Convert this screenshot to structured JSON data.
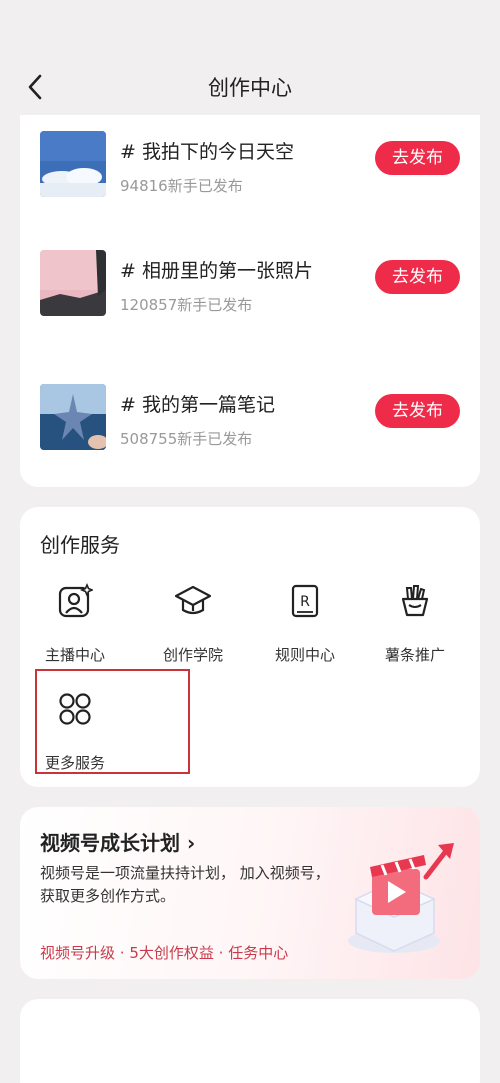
{
  "header": {
    "title": "创作中心"
  },
  "tasks": [
    {
      "title": "# 我拍下的今日天空",
      "sub": "94816新手已发布",
      "button": "去发布"
    },
    {
      "title": "# 相册里的第一张照片",
      "sub": "120857新手已发布",
      "button": "去发布"
    },
    {
      "title": "# 我的第一篇笔记",
      "sub": "508755新手已发布",
      "button": "去发布"
    }
  ],
  "services": {
    "title": "创作服务",
    "items": [
      {
        "label": "主播中心",
        "icon": "anchor-center-icon"
      },
      {
        "label": "创作学院",
        "icon": "graduation-cap-icon"
      },
      {
        "label": "规则中心",
        "icon": "rules-book-icon"
      },
      {
        "label": "薯条推广",
        "icon": "fries-icon"
      },
      {
        "label": "更多服务",
        "icon": "more-grid-icon"
      }
    ]
  },
  "plan": {
    "title": "视频号成长计划 ›",
    "desc": "视频号是一项流量扶持计划， 加入视频号，获取更多创作方式。",
    "links": [
      "视频号升级",
      "5大创作权益",
      "任务中心"
    ],
    "separator": " · "
  },
  "colors": {
    "accent": "#ef2b4a",
    "background": "#f1eff0",
    "highlight_border": "#c9333a"
  }
}
